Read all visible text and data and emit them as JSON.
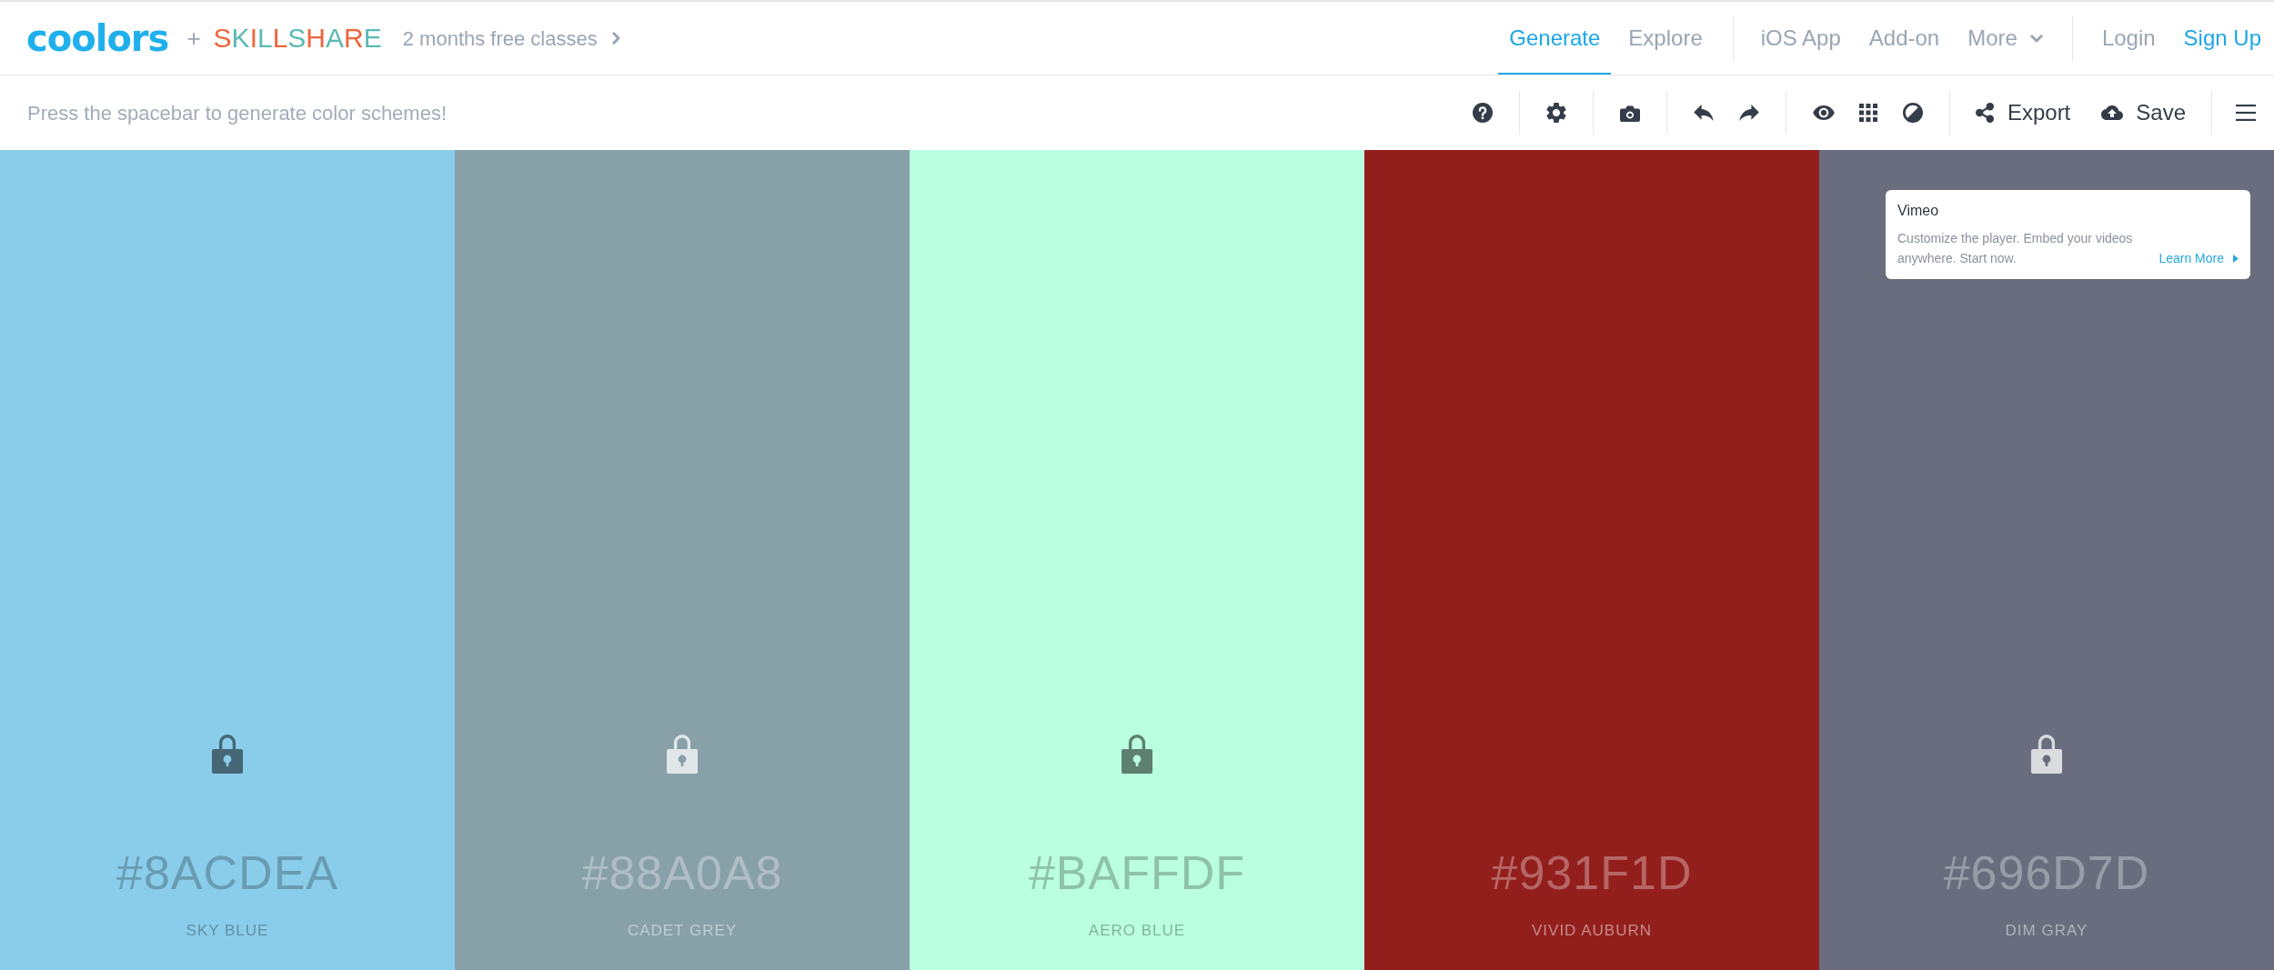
{
  "header": {
    "logo": "coolors",
    "plus": "+",
    "partner": "SKILLSHARE",
    "promo": "2 months free classes",
    "tabs": [
      {
        "label": "Generate",
        "selected": true
      },
      {
        "label": "Explore",
        "selected": false
      }
    ],
    "links": [
      "iOS App",
      "Add-on"
    ],
    "more": "More",
    "account": [
      {
        "kind": "login",
        "label": "Login"
      },
      {
        "kind": "signup",
        "label": "Sign Up"
      }
    ]
  },
  "toolbar": {
    "hint": "Press the spacebar to generate color schemes!",
    "export": "Export",
    "save": "Save"
  },
  "palette": [
    {
      "hex": "#8ACDEA",
      "name": "SKY BLUE",
      "color": "#8acdea",
      "lock_visible": true
    },
    {
      "hex": "#88A0A8",
      "name": "CADET GREY",
      "color": "#88a0a8",
      "lock_visible": true
    },
    {
      "hex": "#BAFFDF",
      "name": "AERO BLUE",
      "color": "#baffdf",
      "lock_visible": true
    },
    {
      "hex": "#931F1D",
      "name": "VIVID AUBURN",
      "color": "#931f1d",
      "lock_visible": false
    },
    {
      "hex": "#696D7D",
      "name": "DIM GRAY",
      "color": "#696d7d",
      "lock_visible": true
    }
  ],
  "ad": {
    "title": "Vimeo",
    "text": "Customize the player. Embed your videos anywhere. Start now.",
    "link": "Learn More"
  }
}
